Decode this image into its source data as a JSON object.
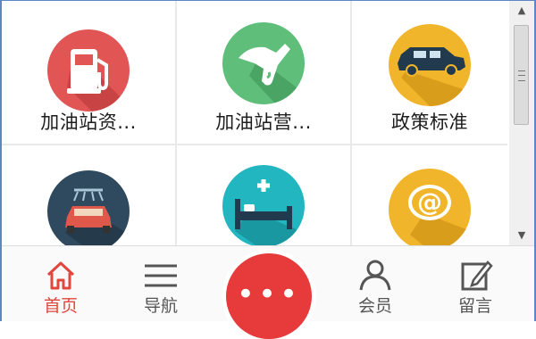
{
  "grid": {
    "items": [
      {
        "label": "加油站资...",
        "icon": "fuel-pump-icon",
        "color": "#e25555"
      },
      {
        "label": "加油站营...",
        "icon": "fuel-nozzle-icon",
        "color": "#5fbf7a"
      },
      {
        "label": "政策标准",
        "icon": "car-icon",
        "color": "#f1b52b"
      },
      {
        "label": "",
        "icon": "car-wash-icon",
        "color": "#2f4a5e"
      },
      {
        "label": "",
        "icon": "hotel-bed-icon",
        "color": "#22b6c0"
      },
      {
        "label": "",
        "icon": "at-sign-icon",
        "color": "#f1b52b"
      }
    ]
  },
  "nav": {
    "home": "首页",
    "guide": "导航",
    "more": "•••",
    "member": "会员",
    "message": "留言"
  },
  "colors": {
    "accent": "#e0463c",
    "fab": "#e63b3a",
    "frame": "#5b87c5"
  },
  "scrollbar": {
    "up": "▲",
    "down": "▼"
  }
}
